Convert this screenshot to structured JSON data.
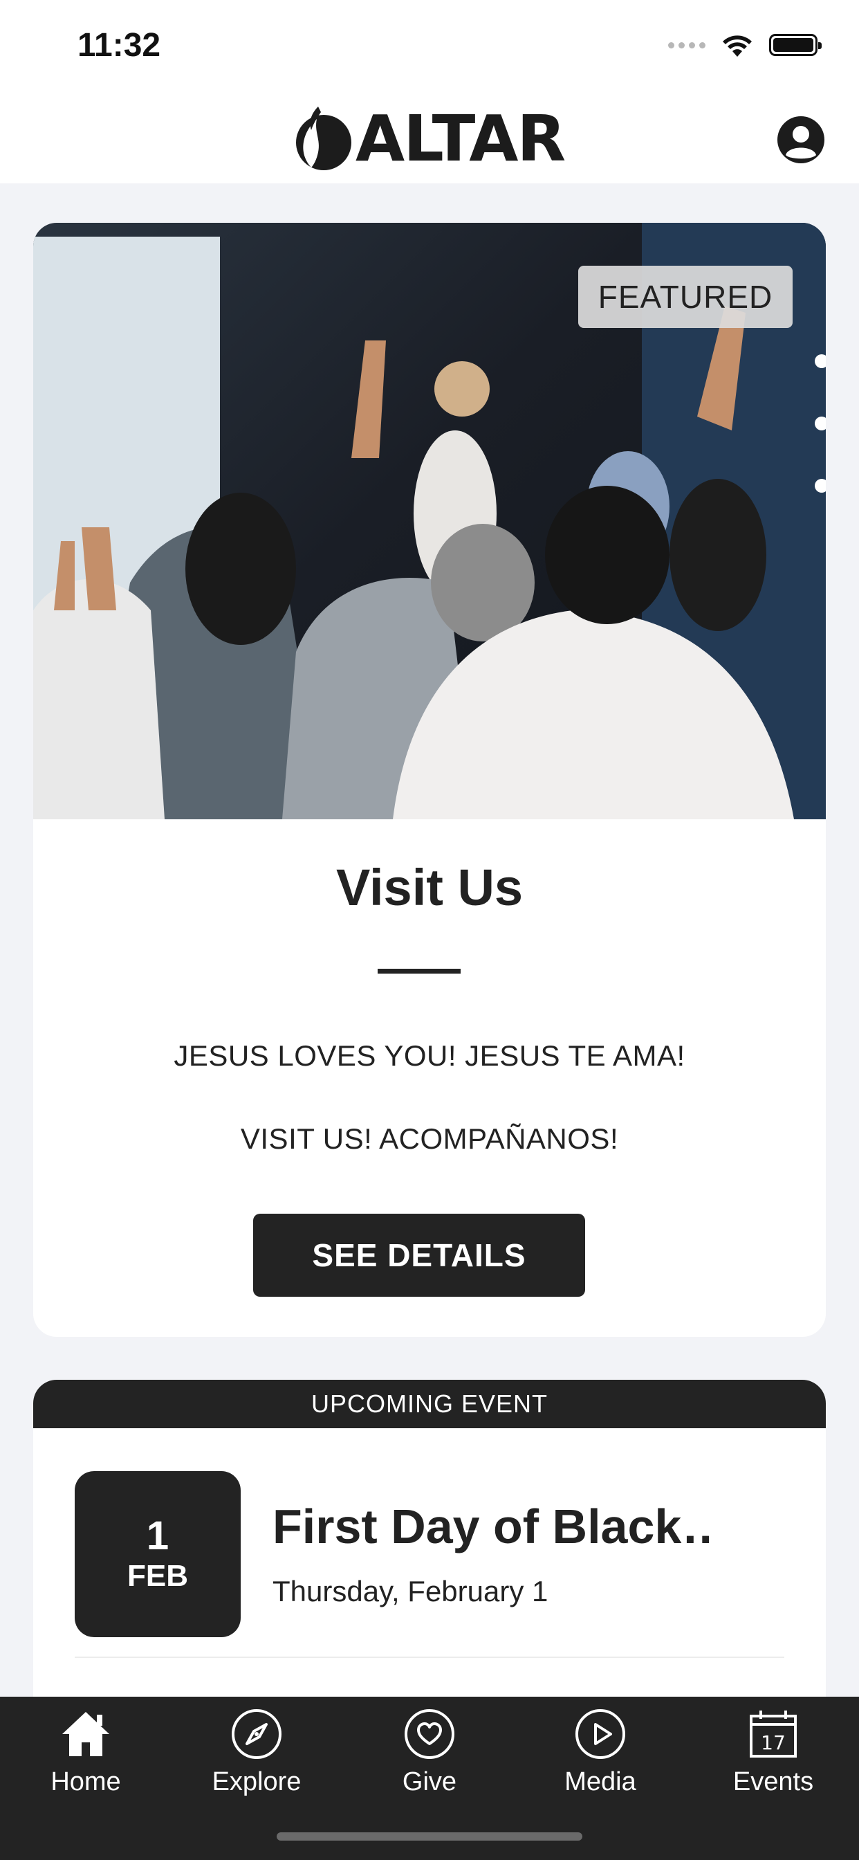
{
  "status_bar": {
    "time": "11:32"
  },
  "header": {
    "logo_text": "ALTAR"
  },
  "featured": {
    "badge": "FEATURED",
    "title": "Visit Us",
    "lines": [
      "JESUS LOVES YOU! JESUS TE AMA!",
      "VISIT US! ACOMPAÑANOS!"
    ],
    "button_label": "SEE DETAILS"
  },
  "upcoming": {
    "header": "UPCOMING EVENT",
    "day": "1",
    "month": "FEB",
    "title": "First Day of Black…",
    "date": "Thursday, February 1"
  },
  "tabs": [
    {
      "label": "Home",
      "icon": "home-icon"
    },
    {
      "label": "Explore",
      "icon": "compass-icon"
    },
    {
      "label": "Give",
      "icon": "heart-icon"
    },
    {
      "label": "Media",
      "icon": "play-icon"
    },
    {
      "label": "Events",
      "icon": "calendar-icon"
    }
  ],
  "colors": {
    "dark": "#232323",
    "background": "#f2f3f7",
    "card": "#ffffff"
  }
}
